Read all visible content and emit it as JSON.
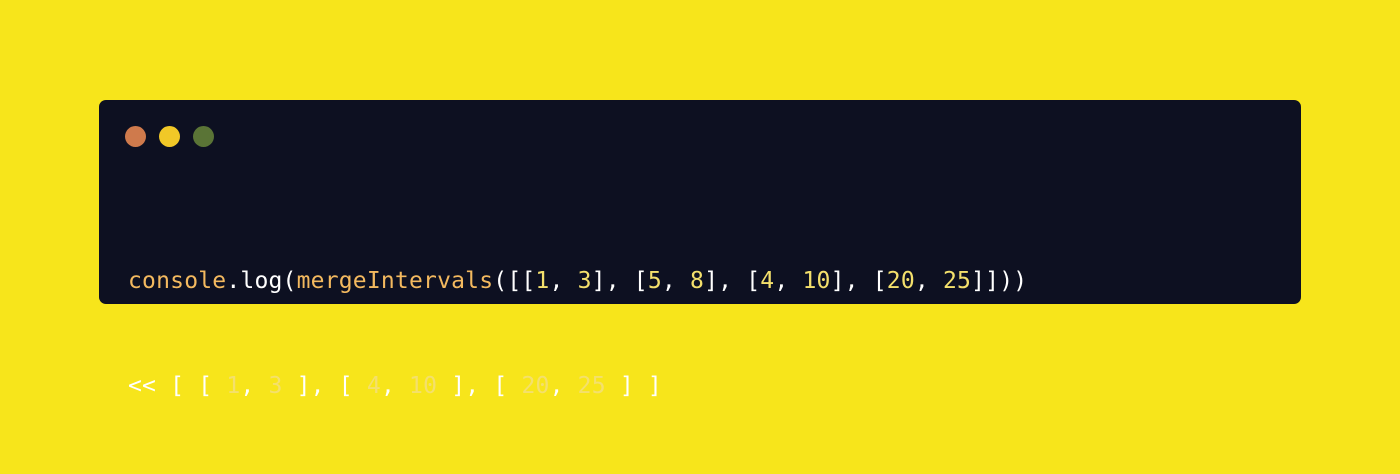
{
  "colors": {
    "background": "#f7e51b",
    "window": "#0d1021",
    "dot_close": "#cf7a4c",
    "dot_minimize": "#f1c827",
    "dot_maximize": "#5a7436",
    "code_plain": "#ffffff",
    "code_identifier": "#f3b95f",
    "code_number": "#f4e06c"
  },
  "window": {
    "title_dots": [
      "close",
      "minimize",
      "maximize"
    ]
  },
  "code": {
    "lines": [
      [
        {
          "text": "console",
          "kind": "identifier"
        },
        {
          "text": ".log(",
          "kind": "plain"
        },
        {
          "text": "mergeIntervals",
          "kind": "identifier"
        },
        {
          "text": "([[",
          "kind": "plain"
        },
        {
          "text": "1",
          "kind": "number"
        },
        {
          "text": ", ",
          "kind": "plain"
        },
        {
          "text": "3",
          "kind": "number"
        },
        {
          "text": "], [",
          "kind": "plain"
        },
        {
          "text": "5",
          "kind": "number"
        },
        {
          "text": ", ",
          "kind": "plain"
        },
        {
          "text": "8",
          "kind": "number"
        },
        {
          "text": "], [",
          "kind": "plain"
        },
        {
          "text": "4",
          "kind": "number"
        },
        {
          "text": ", ",
          "kind": "plain"
        },
        {
          "text": "10",
          "kind": "number"
        },
        {
          "text": "], [",
          "kind": "plain"
        },
        {
          "text": "20",
          "kind": "number"
        },
        {
          "text": ", ",
          "kind": "plain"
        },
        {
          "text": "25",
          "kind": "number"
        },
        {
          "text": "]]))",
          "kind": "plain"
        }
      ],
      [
        {
          "text": "<< [ [ ",
          "kind": "plain"
        },
        {
          "text": "1",
          "kind": "number"
        },
        {
          "text": ", ",
          "kind": "plain"
        },
        {
          "text": "3",
          "kind": "number"
        },
        {
          "text": " ], [ ",
          "kind": "plain"
        },
        {
          "text": "4",
          "kind": "number"
        },
        {
          "text": ", ",
          "kind": "plain"
        },
        {
          "text": "10",
          "kind": "number"
        },
        {
          "text": " ], [ ",
          "kind": "plain"
        },
        {
          "text": "20",
          "kind": "number"
        },
        {
          "text": ", ",
          "kind": "plain"
        },
        {
          "text": "25",
          "kind": "number"
        },
        {
          "text": " ] ]",
          "kind": "plain"
        }
      ]
    ]
  }
}
